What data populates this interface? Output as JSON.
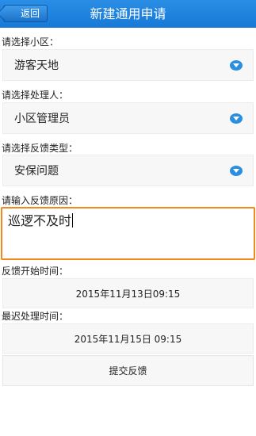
{
  "header": {
    "back_label": "返回",
    "title": "新建通用申请"
  },
  "form": {
    "community": {
      "label": "请选择小区：",
      "value": "游客天地"
    },
    "handler": {
      "label": "请选择处理人：",
      "value": "小区管理员"
    },
    "feedback_type": {
      "label": "请选择反馈类型：",
      "value": "安保问题"
    },
    "reason": {
      "label": "请输入反馈原因：",
      "value": "巡逻不及时"
    },
    "start_time": {
      "label": "反馈开始时间：",
      "value": "2015年11月13日09:15"
    },
    "latest_time": {
      "label": "最迟处理时间：",
      "value": "2015年11月15日 09:15"
    },
    "submit_label": "提交反馈"
  },
  "colors": {
    "header_blue": "#1f84df",
    "focus_orange": "#f08a1c",
    "dropdown_icon_blue": "#2b8fe0"
  },
  "icons": {
    "back": "back-arrow-icon",
    "dropdown": "chevron-down-icon"
  }
}
